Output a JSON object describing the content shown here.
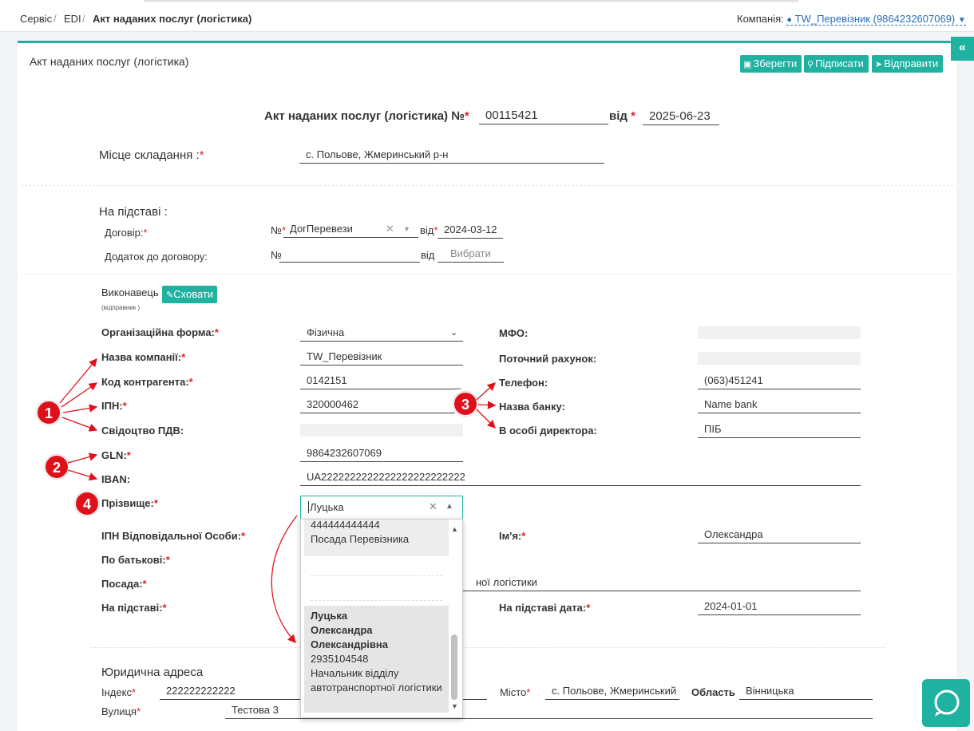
{
  "breadcrumbs": [
    "Сервіс",
    "EDI",
    "Акт наданих послуг (логістика)"
  ],
  "breadcrumb_sep": "/",
  "company": {
    "label": "Компанія:",
    "value": "TW_Перевізник (9864232607069)"
  },
  "page_title": "Акт наданих послуг (логістика)",
  "toolbar": {
    "save": "Зберегти",
    "sign": "Підписати",
    "send": "Відправити"
  },
  "doc": {
    "heading": "Акт наданих послуг (логістика) №",
    "number": "00115421",
    "from": "від",
    "date": "2025-06-23"
  },
  "place": {
    "label": "Місце складання :",
    "value": "с. Польове, Жмеринський р-н"
  },
  "basis": {
    "title": "На підставі :",
    "contract_label": "Договір:",
    "no": "№",
    "contract_value": "ДогПеревези",
    "from": "від",
    "contract_date": "2024-03-12",
    "addendum_label": "Додаток до договору:",
    "addendum_date_placeholder": "Вибрати"
  },
  "executor": {
    "title": "Виконавець",
    "subtitle": "(відправник )",
    "hide_button": "Сховати",
    "org_form_label": "Організаційна форма:",
    "org_form_value": "Фізична",
    "company_name_label": "Назва компанії:",
    "company_name_value": "TW_Перевізник",
    "code_label": "Код контрагента:",
    "code_value": "0142151",
    "code_suffix": "_",
    "ipn_label": "ІПН:",
    "ipn_value": "320000462",
    "vat_label": "Свідоцтво ПДВ:",
    "gln_label": "GLN:",
    "gln_value": "9864232607069",
    "iban_label": "IBAN:",
    "iban_value": "UA2222222222222222222222222",
    "mfo_label": "МФО:",
    "account_label": "Поточний рахунок:",
    "phone_label": "Телефон:",
    "phone_value": "(063)451241",
    "bank_label": "Назва банку:",
    "bank_value": "Name bank",
    "director_label": "В особі директора:",
    "director_value": "ПІБ",
    "surname_label": "Прізвище:",
    "surname_value": "Луцька",
    "resp_ipn_label": "ІПН Відповідальної Особи:",
    "name_label": "Ім'я:",
    "name_value": "Олександра",
    "patronymic_label": "По батькові:",
    "position_label": "Посада:",
    "position_value_tail": "ної логістики",
    "basis_label": "На підставі:",
    "basis_date_label": "На підставі дата:",
    "basis_date_value": "2024-01-01"
  },
  "dropdown": {
    "option1": {
      "line1": "444444444444",
      "line2": "Посада Перевізника"
    },
    "option_selected": {
      "surname": "Луцька",
      "name": "Олександра",
      "patronymic": "Олександрівна",
      "ipn": "2935104548",
      "position": "Начальник відділу автотранспортної логістики"
    }
  },
  "address": {
    "title": "Юридична адреса",
    "index_label": "Індекс",
    "index_value": "222222222222",
    "city_label": "Місто",
    "city_value": "с. Польове, Жмеринський р",
    "region_label": "Область",
    "region_value": "Вінницька",
    "street_label": "Вулиця",
    "street_value": "Тестова 3"
  },
  "markers": [
    "1",
    "2",
    "3",
    "4"
  ],
  "colors": {
    "accent": "#1fb2a0",
    "required": "#e0202a",
    "marker": "#e0101a",
    "link": "#2a6ebb"
  },
  "icons": {
    "save": "floppy-icon",
    "sign": "key-icon",
    "send": "paper-plane-icon",
    "hide": "pencil-icon",
    "chat": "chat-bubble-icon",
    "collapse": "double-chevron-left-icon"
  }
}
